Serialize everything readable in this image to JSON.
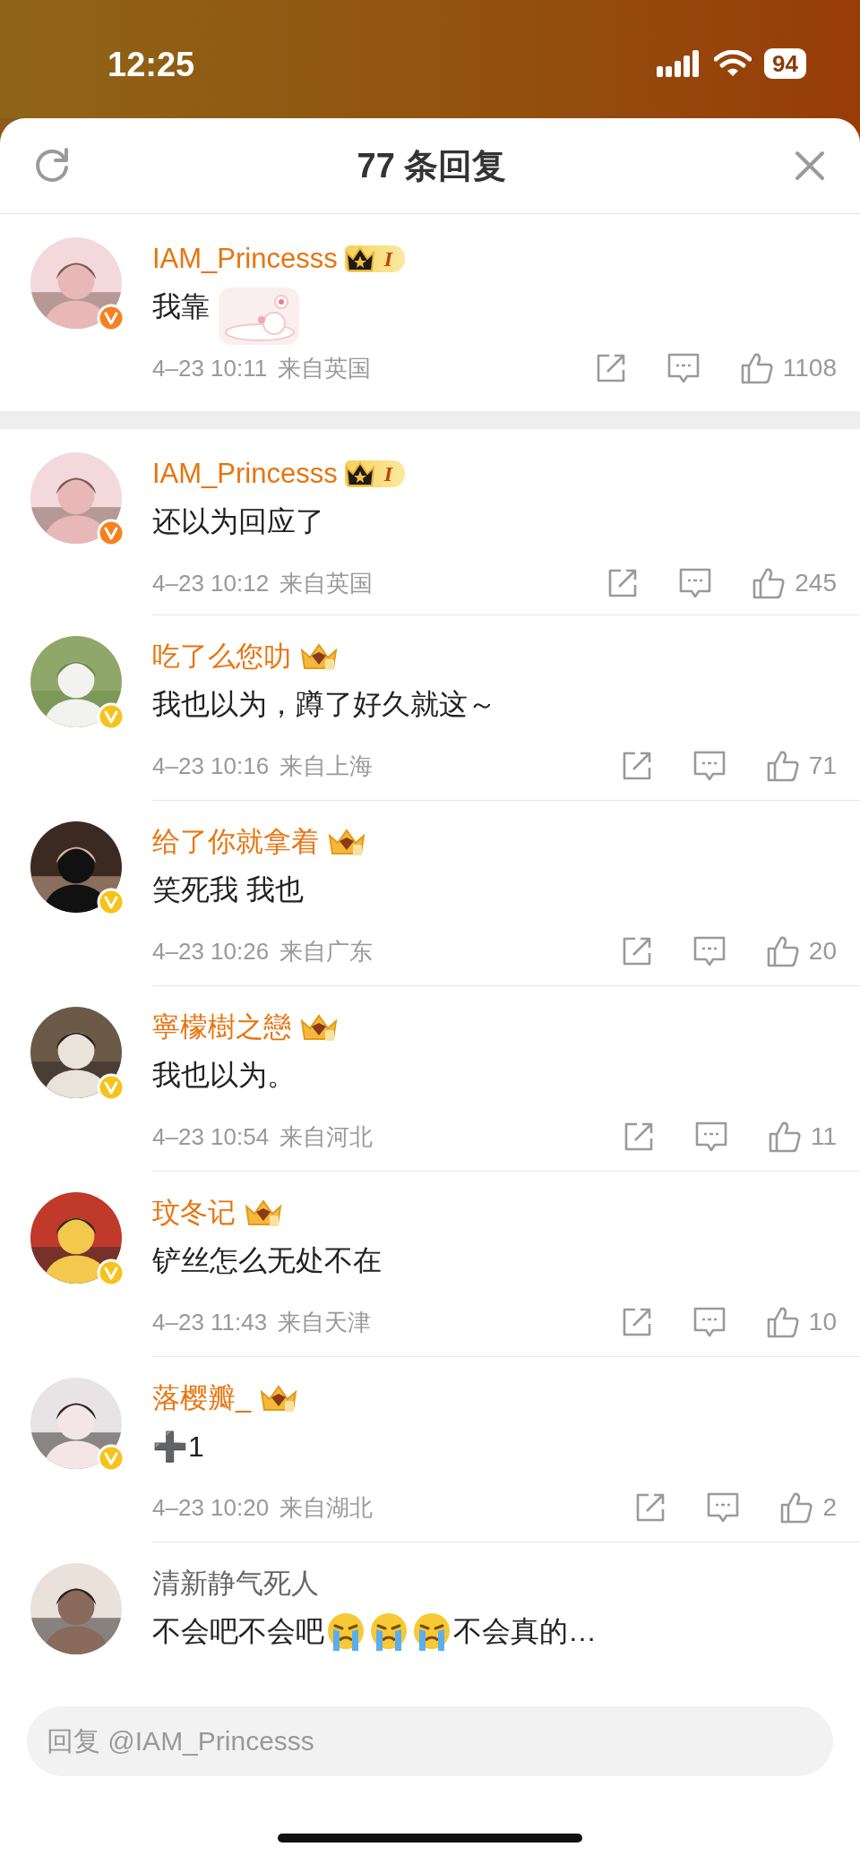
{
  "status_bar": {
    "time": "12:25",
    "battery": "94"
  },
  "sheet": {
    "title": "77 条回复"
  },
  "root_comment": {
    "name": "IAM_Princesss",
    "vip": true,
    "badge": {
      "kind": "level",
      "level": "I"
    },
    "verified": {
      "color": "#f5821f"
    },
    "body": [
      {
        "kind": "text",
        "text": "我靠"
      },
      {
        "kind": "sticker"
      }
    ],
    "meta": {
      "date": "4–23 10:11",
      "location": "来自英国",
      "likes": "1108"
    }
  },
  "replies": [
    {
      "name": "IAM_Princesss",
      "vip": true,
      "badge": {
        "kind": "level",
        "level": "I"
      },
      "verified": {
        "color": "#f5821f"
      },
      "body": [
        {
          "kind": "text",
          "text": "还以为回应了"
        }
      ],
      "meta": {
        "date": "4–23 10:12",
        "location": "来自英国",
        "likes": "245"
      }
    },
    {
      "name": "吃了么您叻",
      "vip": true,
      "badge": {
        "kind": "crown"
      },
      "verified": {
        "color": "#f7c21a"
      },
      "body": [
        {
          "kind": "text",
          "text": "我也以为，蹲了好久就这～"
        }
      ],
      "meta": {
        "date": "4–23 10:16",
        "location": "来自上海",
        "likes": "71"
      }
    },
    {
      "name": "给了你就拿着",
      "vip": true,
      "badge": {
        "kind": "crown"
      },
      "verified": {
        "color": "#f7c21a"
      },
      "body": [
        {
          "kind": "text",
          "text": "笑死我 我也"
        }
      ],
      "meta": {
        "date": "4–23 10:26",
        "location": "来自广东",
        "likes": "20"
      }
    },
    {
      "name": "寧檬樹之戀",
      "vip": true,
      "badge": {
        "kind": "crown"
      },
      "verified": {
        "color": "#f7c21a"
      },
      "body": [
        {
          "kind": "text",
          "text": "我也以为。"
        }
      ],
      "meta": {
        "date": "4–23 10:54",
        "location": "来自河北",
        "likes": "11"
      }
    },
    {
      "name": "玟冬记",
      "vip": true,
      "badge": {
        "kind": "crown"
      },
      "verified": {
        "color": "#f7c21a"
      },
      "body": [
        {
          "kind": "text",
          "text": "铲丝怎么无处不在"
        }
      ],
      "meta": {
        "date": "4–23 11:43",
        "location": "来自天津",
        "likes": "10"
      }
    },
    {
      "name": "落樱瓣_",
      "vip": true,
      "badge": {
        "kind": "crown"
      },
      "verified": {
        "color": "#f7c21a"
      },
      "body": [
        {
          "kind": "text",
          "text": "➕1"
        }
      ],
      "meta": {
        "date": "4–23 10:20",
        "location": "来自湖北",
        "likes": "2"
      }
    },
    {
      "name": "清新静气死人",
      "vip": false,
      "body": [
        {
          "kind": "text",
          "text": "不会吧不会吧"
        },
        {
          "kind": "emoji"
        },
        {
          "kind": "emoji"
        },
        {
          "kind": "emoji"
        },
        {
          "kind": "text",
          "text": "不会真的…"
        }
      ]
    }
  ],
  "reply_field": {
    "placeholder": "回复 @IAM_Princesss"
  }
}
